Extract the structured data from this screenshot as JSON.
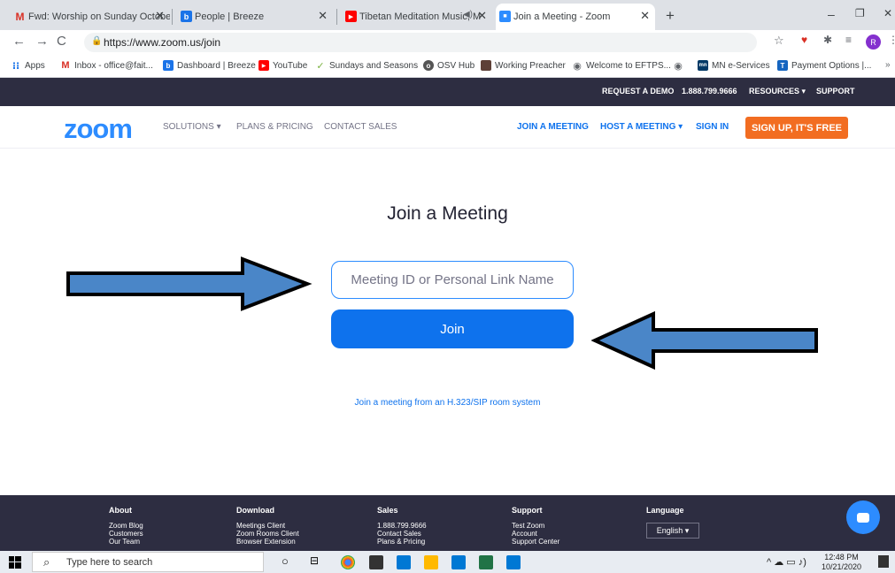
{
  "browser": {
    "tabs": [
      {
        "label": "Fwd: Worship on Sunday Octobe",
        "icon": "gmail-icon",
        "active": false
      },
      {
        "label": "People | Breeze",
        "icon": "breeze-icon",
        "active": false
      },
      {
        "label": "Tibetan Meditation Music, M",
        "icon": "youtube-icon",
        "active": false
      },
      {
        "label": "Join a Meeting - Zoom",
        "icon": "zoom-icon",
        "active": true
      }
    ],
    "new_tab": "+",
    "url": "https://www.zoom.us/join",
    "profile_initial": "R",
    "bookmarks": [
      {
        "label": "Apps"
      },
      {
        "label": "Inbox - office@fait..."
      },
      {
        "label": "Dashboard | Breeze"
      },
      {
        "label": "YouTube"
      },
      {
        "label": "Sundays and Seasons"
      },
      {
        "label": "OSV Hub"
      },
      {
        "label": "Working Preacher"
      },
      {
        "label": "Welcome to EFTPS..."
      },
      {
        "label": ""
      },
      {
        "label": "MN e-Services"
      },
      {
        "label": "Payment Options |..."
      }
    ]
  },
  "zoom_top": {
    "request_demo": "REQUEST A DEMO",
    "phone": "1.888.799.9666",
    "resources": "RESOURCES ▾",
    "support": "SUPPORT"
  },
  "zoom_nav": {
    "logo": "zoom",
    "solutions": "SOLUTIONS ▾",
    "plans": "PLANS & PRICING",
    "contact": "CONTACT SALES",
    "join": "JOIN A MEETING",
    "host": "HOST A MEETING ▾",
    "signin": "SIGN IN",
    "signup": "SIGN UP, IT'S FREE"
  },
  "main": {
    "title": "Join a Meeting",
    "input_placeholder": "Meeting ID or Personal Link Name",
    "join_label": "Join",
    "h323_link": "Join a meeting from an H.323/SIP room system"
  },
  "footer": {
    "columns": [
      {
        "heading": "About",
        "links": [
          "Zoom Blog",
          "Customers",
          "Our Team"
        ]
      },
      {
        "heading": "Download",
        "links": [
          "Meetings Client",
          "Zoom Rooms Client",
          "Browser Extension"
        ]
      },
      {
        "heading": "Sales",
        "links": [
          "1.888.799.9666",
          "Contact Sales",
          "Plans & Pricing"
        ]
      },
      {
        "heading": "Support",
        "links": [
          "Test Zoom",
          "Account",
          "Support Center"
        ]
      },
      {
        "heading": "Language",
        "links": []
      }
    ],
    "language_value": "English ▾"
  },
  "taskbar": {
    "search_placeholder": "Type here to search",
    "time": "12:48 PM",
    "date": "10/21/2020"
  },
  "colors": {
    "zoom_blue": "#2d8cff",
    "join_blue": "#0e72ed",
    "signup_orange": "#f26d21",
    "dark_bar": "#2d2d41"
  }
}
